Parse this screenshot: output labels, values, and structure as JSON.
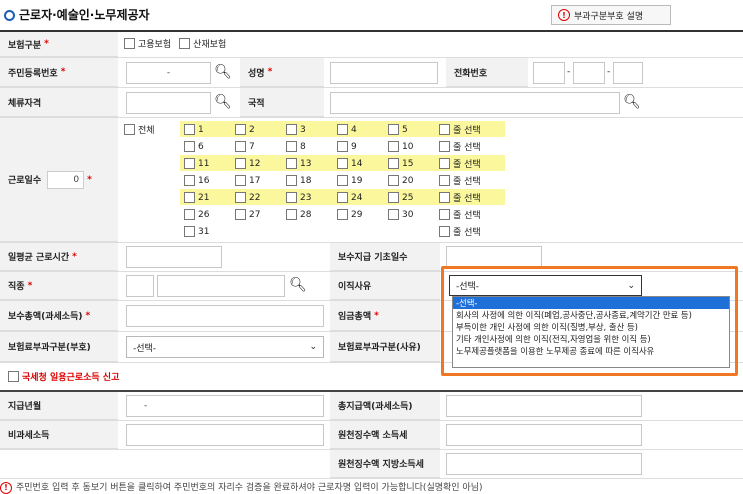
{
  "header": {
    "title": "근로자·예술인·노무제공자",
    "help_button": "부과구분부호 설명"
  },
  "insurance_type": {
    "label": "보험구분",
    "options": [
      "고용보험",
      "산재보험"
    ]
  },
  "resident_no": {
    "label": "주민등록번호",
    "separator": "-"
  },
  "name": {
    "label": "성명"
  },
  "phone": {
    "label": "전화번호",
    "sep1": "-",
    "sep2": "-"
  },
  "stay_status": {
    "label": "체류자격"
  },
  "nationality": {
    "label": "국적"
  },
  "work_days": {
    "label": "근로일수",
    "value": "0",
    "all_label": "전체",
    "rows": [
      {
        "days": [
          "1",
          "2",
          "3",
          "4",
          "5"
        ],
        "highlight": true
      },
      {
        "days": [
          "6",
          "7",
          "8",
          "9",
          "10"
        ],
        "highlight": false
      },
      {
        "days": [
          "11",
          "12",
          "13",
          "14",
          "15"
        ],
        "highlight": true
      },
      {
        "days": [
          "16",
          "17",
          "18",
          "19",
          "20"
        ],
        "highlight": false
      },
      {
        "days": [
          "21",
          "22",
          "23",
          "24",
          "25"
        ],
        "highlight": true
      },
      {
        "days": [
          "26",
          "27",
          "28",
          "29",
          "30"
        ],
        "highlight": false
      },
      {
        "days": [
          "31"
        ],
        "highlight": false
      }
    ],
    "row_select_label": "줄 선택"
  },
  "avg_hours": {
    "label": "일평균 근로시간"
  },
  "pay_base_days": {
    "label": "보수지급 기초일수"
  },
  "job_type": {
    "label": "직종"
  },
  "leave_reason": {
    "label": "이직사유",
    "selected": "-선택-",
    "options": [
      "-선택-",
      "회사의 사정에 의한 이직(폐업,공사중단,공사종료,계약기간 만료 등)",
      "부득이한 개인 사정에 의한 이직(질병,부상, 출산 등)",
      "기타 개인사정에 의한 이직(전직,자영업을 위한 이직 등)",
      "노무제공플랫폼을 이용한 노무제공 종료에 따른 이직사유"
    ]
  },
  "total_pay": {
    "label": "보수총액(과세소득)"
  },
  "total_wage": {
    "label": "임금총액"
  },
  "levy_code_notice": {
    "label": "보험료부과구분(부호)",
    "selected": "-선택-"
  },
  "levy_code_reason": {
    "label": "보험료부과구분(사유)"
  },
  "nts_report": {
    "label": "국세청 일용근로소득 신고"
  },
  "pay_year_month": {
    "label": "지급년월",
    "value": "-"
  },
  "total_payment": {
    "label": "총지급액(과세소득)"
  },
  "nontax_income": {
    "label": "비과세소득"
  },
  "withhold_income_tax": {
    "label": "원천징수액 소득세"
  },
  "withhold_local_tax": {
    "label": "원천징수액 지방소득세"
  },
  "footnote": {
    "text": "주민번호 입력 후 동보기 버튼을 클릭하여 주민번호의 자리수 검증을 완료하셔야 근로자명 입력이 가능합니다(실명확인 아님)"
  }
}
